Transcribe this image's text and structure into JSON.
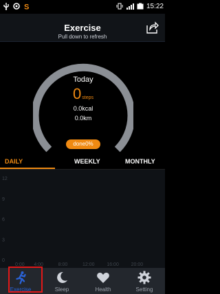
{
  "status_bar": {
    "time": "15:22",
    "network": "4G"
  },
  "header": {
    "title": "Exercise",
    "subtitle": "Pull down to refresh"
  },
  "summary": {
    "label": "Today",
    "steps_value": "0",
    "steps_unit": "steps",
    "kcal": "0.0kcal",
    "km": "0.0km",
    "goal_button": "done0%",
    "progress_fraction": 0.0
  },
  "tabs": [
    {
      "label": "DAILY",
      "active": true
    },
    {
      "label": "WEEKLY",
      "active": false
    },
    {
      "label": "MONTHLY",
      "active": false
    }
  ],
  "colors": {
    "accent": "#f08a12",
    "nav_active": "#2a63d8",
    "highlight": "#e21818"
  },
  "chart_data": {
    "type": "bar",
    "x_ticks": [
      "0:00",
      "4:00",
      "8:00",
      "12:00",
      "16:00",
      "20:00"
    ],
    "y_ticks": [
      0,
      3,
      6,
      9,
      12
    ],
    "ylim": [
      0,
      12
    ],
    "values": [],
    "grid": false
  },
  "bottom_nav": [
    {
      "label": "Exercise",
      "icon": "runner-icon",
      "active": true
    },
    {
      "label": "Sleep",
      "icon": "moon-icon",
      "active": false
    },
    {
      "label": "Health",
      "icon": "heart-icon",
      "active": false
    },
    {
      "label": "Setting",
      "icon": "gear-icon",
      "active": false
    }
  ]
}
